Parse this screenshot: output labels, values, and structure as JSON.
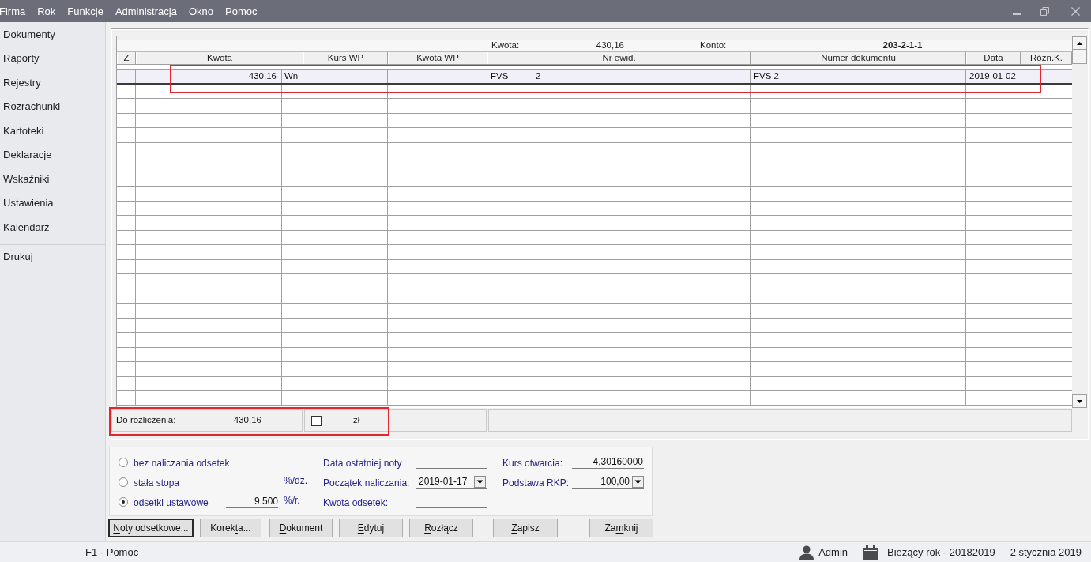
{
  "menu": [
    "Firma",
    "Rok",
    "Funkcje",
    "Administracja",
    "Okno",
    "Pomoc"
  ],
  "sidebar": {
    "items": [
      "Dokumenty",
      "Raporty",
      "Rejestry",
      "Rozrachunki",
      "Kartoteki",
      "Deklaracje",
      "Wskaźniki",
      "Ustawienia",
      "Kalendarz"
    ],
    "footer_items": [
      "Drukuj"
    ]
  },
  "ledger": {
    "header": {
      "amount_label": "Kwota:",
      "amount": "430,16",
      "account_label": "Konto:",
      "account": "203-2-1-1"
    },
    "columns": [
      "Z",
      "Kwota",
      "Kurs WP",
      "Kwota WP",
      "Nr ewid.",
      "Numer dokumentu",
      "Data",
      "Różn.K."
    ],
    "rows": [
      {
        "amount": "430,16",
        "side": "Wn",
        "register_code": "FVS",
        "register_number": "2",
        "document_number": "FVS 2",
        "date": "2019-01-02",
        "selected": true,
        "highlighted": true
      }
    ]
  },
  "settlement": {
    "label": "Do rozliczenia:",
    "amount": "430,16",
    "currency_checked": false,
    "currency": "zł",
    "highlighted": true
  },
  "interest": {
    "options": [
      {
        "label": "bez naliczania odsetek",
        "selected": false
      },
      {
        "label": "stała stopa",
        "selected": false,
        "unit": "%/dz."
      },
      {
        "label": "odsetki ustawowe",
        "selected": true,
        "value": "9,500",
        "unit": "%/r."
      }
    ],
    "fields": [
      {
        "label": "Data ostatniej noty",
        "kind": "field"
      },
      {
        "label": "Początek naliczania:",
        "kind": "dropdown",
        "value": "2019-01-17"
      },
      {
        "label": "Kwota odsetek:",
        "kind": "field"
      }
    ],
    "rates": [
      {
        "label": "Kurs otwarcia:",
        "kind": "field",
        "value": "4,30160000"
      },
      {
        "label": "Podstawa RKP:",
        "kind": "dropdown",
        "value": "100,00"
      }
    ]
  },
  "buttons": [
    {
      "mnemonic": "N",
      "after": "oty odsetkowe...",
      "default": true
    },
    {
      "before": "Korek",
      "mnemonic": "t",
      "after": "a...",
      "default": false
    },
    {
      "mnemonic": "D",
      "after": "okument",
      "default": false
    },
    {
      "mnemonic": "E",
      "after": "dytuj",
      "default": false
    },
    {
      "mnemonic": "R",
      "after": "ozłącz",
      "default": false
    },
    {
      "mnemonic": "Z",
      "after": "apisz",
      "default": false
    },
    {
      "before": "Za",
      "mnemonic": "m",
      "after": "knij",
      "default": false
    }
  ],
  "status_bar": {
    "help": "F1 - Pomoc",
    "user": "Admin",
    "year": "Bieżący rok - 20182019",
    "date": "2 stycznia 2019"
  }
}
